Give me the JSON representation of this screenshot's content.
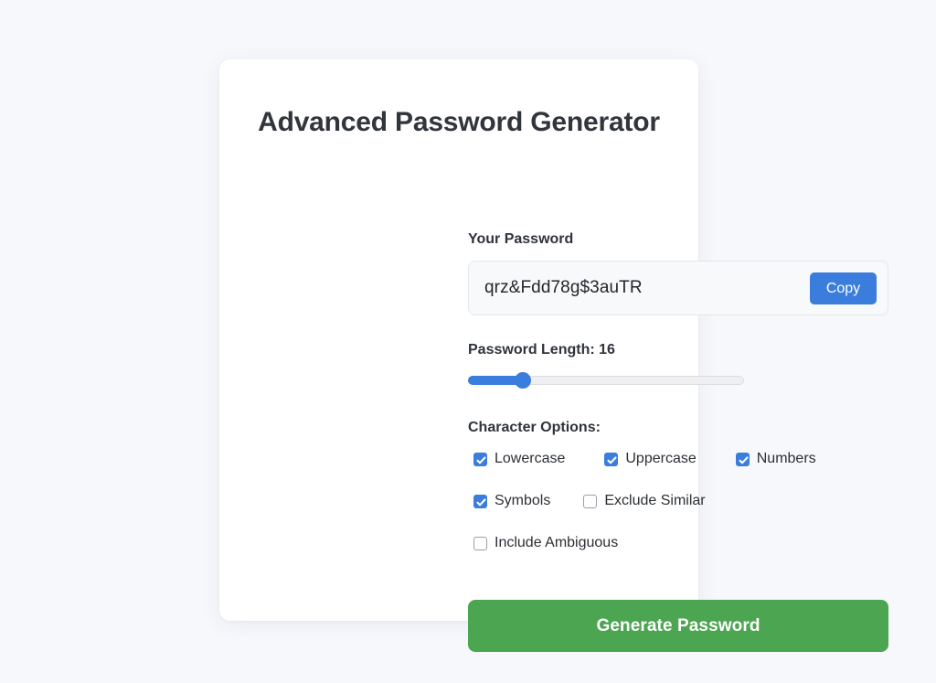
{
  "page": {
    "background_color": "#f7f8fc"
  },
  "card": {
    "title": "Advanced Password Generator",
    "background_color": "#ffffff"
  },
  "password": {
    "label": "Your Password",
    "value": "qrz&Fdd78g$3auTR",
    "copy_label": "Copy",
    "copy_color": "#3b7ddd"
  },
  "length": {
    "label": "Password Length: 16",
    "value": 16,
    "min": 4,
    "max": 64,
    "fill_percent": 20,
    "accent_color": "#3b7ddd"
  },
  "options": {
    "label": "Character Options:",
    "rows": [
      [
        {
          "label": "Lowercase",
          "checked": true,
          "name": "lowercase"
        },
        {
          "label": "Uppercase",
          "checked": true,
          "name": "uppercase"
        },
        {
          "label": "Numbers",
          "checked": true,
          "name": "numbers"
        }
      ],
      [
        {
          "label": "Symbols",
          "checked": true,
          "name": "symbols"
        },
        {
          "label": "Exclude Similar",
          "checked": false,
          "name": "exclude-similar"
        }
      ],
      [
        {
          "label": "Include Ambiguous",
          "checked": false,
          "name": "include-ambiguous"
        }
      ]
    ]
  },
  "generate": {
    "label": "Generate Password",
    "color": "#4ca551"
  }
}
